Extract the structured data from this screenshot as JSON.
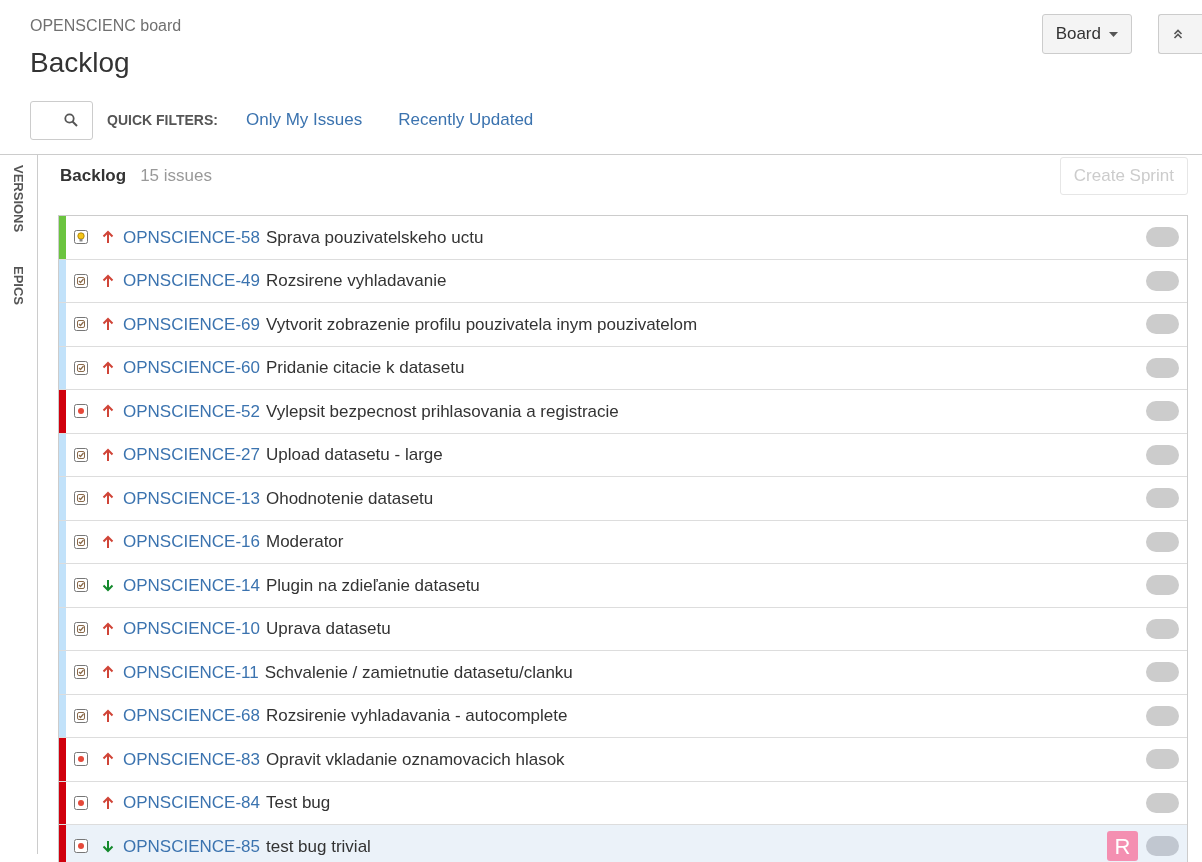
{
  "header": {
    "board_name": "OPENSCIENC board",
    "title": "Backlog",
    "board_button": "Board"
  },
  "filters": {
    "label": "QUICK FILTERS:",
    "items": [
      "Only My Issues",
      "Recently Updated"
    ]
  },
  "side_tabs": [
    "VERSIONS",
    "EPICS"
  ],
  "backlog": {
    "title": "Backlog",
    "count": "15 issues",
    "create_button": {
      "label": "Create Sprint",
      "disabled": true
    },
    "issues": [
      {
        "key": "OPNSCIENCE-58",
        "summary": "Sprava pouzivatelskeho uctu",
        "type_icon": {
          "kind": "idea"
        },
        "priority_icon": {
          "kind": "up"
        },
        "color": "#6bc43f",
        "selected": false
      },
      {
        "key": "OPNSCIENCE-49",
        "summary": "Rozsirene vyhladavanie",
        "type_icon": {
          "kind": "story"
        },
        "priority_icon": {
          "kind": "up"
        },
        "color": "#c2e2fa",
        "selected": false
      },
      {
        "key": "OPNSCIENCE-69",
        "summary": "Vytvorit zobrazenie profilu pouzivatela inym pouzivatelom",
        "type_icon": {
          "kind": "story"
        },
        "priority_icon": {
          "kind": "up"
        },
        "color": "#c2e2fa",
        "selected": false
      },
      {
        "key": "OPNSCIENCE-60",
        "summary": "Pridanie citacie k datasetu",
        "type_icon": {
          "kind": "story"
        },
        "priority_icon": {
          "kind": "up"
        },
        "color": "#c2e2fa",
        "selected": false
      },
      {
        "key": "OPNSCIENCE-52",
        "summary": "Vylepsit bezpecnost prihlasovania a registracie",
        "type_icon": {
          "kind": "bug"
        },
        "priority_icon": {
          "kind": "up"
        },
        "color": "#d0000d",
        "selected": false
      },
      {
        "key": "OPNSCIENCE-27",
        "summary": "Upload datasetu - large",
        "type_icon": {
          "kind": "story"
        },
        "priority_icon": {
          "kind": "up"
        },
        "color": "#c2e2fa",
        "selected": false
      },
      {
        "key": "OPNSCIENCE-13",
        "summary": "Ohodnotenie datasetu",
        "type_icon": {
          "kind": "story"
        },
        "priority_icon": {
          "kind": "up"
        },
        "color": "#c2e2fa",
        "selected": false
      },
      {
        "key": "OPNSCIENCE-16",
        "summary": "Moderator",
        "type_icon": {
          "kind": "story"
        },
        "priority_icon": {
          "kind": "up"
        },
        "color": "#c2e2fa",
        "selected": false
      },
      {
        "key": "OPNSCIENCE-14",
        "summary": "Plugin na zdieľanie datasetu",
        "type_icon": {
          "kind": "story"
        },
        "priority_icon": {
          "kind": "down"
        },
        "color": "#c2e2fa",
        "selected": false
      },
      {
        "key": "OPNSCIENCE-10",
        "summary": "Uprava datasetu",
        "type_icon": {
          "kind": "story"
        },
        "priority_icon": {
          "kind": "up"
        },
        "color": "#c2e2fa",
        "selected": false
      },
      {
        "key": "OPNSCIENCE-11",
        "summary": "Schvalenie / zamietnutie datasetu/clanku",
        "type_icon": {
          "kind": "story"
        },
        "priority_icon": {
          "kind": "up"
        },
        "color": "#c2e2fa",
        "selected": false
      },
      {
        "key": "OPNSCIENCE-68",
        "summary": "Rozsirenie vyhladavania - autocomplete",
        "type_icon": {
          "kind": "story"
        },
        "priority_icon": {
          "kind": "up"
        },
        "color": "#c2e2fa",
        "selected": false
      },
      {
        "key": "OPNSCIENCE-83",
        "summary": "Opravit vkladanie oznamovacich hlasok",
        "type_icon": {
          "kind": "bug"
        },
        "priority_icon": {
          "kind": "up"
        },
        "color": "#d0000d",
        "selected": false
      },
      {
        "key": "OPNSCIENCE-84",
        "summary": "Test bug",
        "type_icon": {
          "kind": "bug"
        },
        "priority_icon": {
          "kind": "up"
        },
        "color": "#d0000d",
        "selected": false
      },
      {
        "key": "OPNSCIENCE-85",
        "summary": "test bug trivial",
        "type_icon": {
          "kind": "bug"
        },
        "priority_icon": {
          "kind": "down"
        },
        "color": "#d0000d",
        "selected": true,
        "assignee": "R"
      }
    ]
  }
}
